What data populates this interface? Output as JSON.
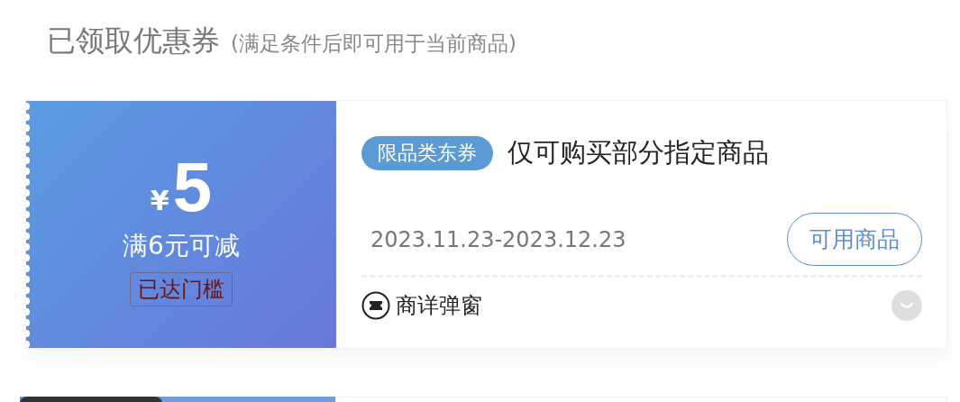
{
  "header": {
    "title": "已领取优惠券",
    "subtitle": "(满足条件后即可用于当前商品)"
  },
  "coupons": [
    {
      "currency": "¥",
      "amount": "5",
      "condition": "满6元可减",
      "threshold_badge": "已达门槛",
      "threshold_reached": true,
      "tag": "限品类东券",
      "description": "仅可购买部分指定商品",
      "validity": "2023.11.23-2023.12.23",
      "action": "可用商品",
      "footer_note": "商详弹窗",
      "expanded": false
    }
  ]
}
